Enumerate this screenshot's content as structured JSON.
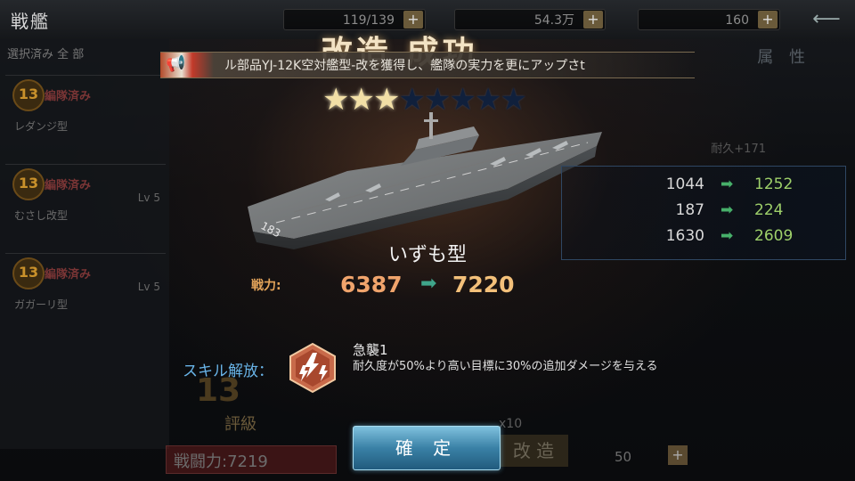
{
  "header": {
    "title": "戦艦",
    "resources": [
      {
        "value": "119/139"
      },
      {
        "value": "54.3万"
      },
      {
        "value": "160"
      }
    ],
    "plus_label": "+"
  },
  "left_list": {
    "filter_label": "選択済み 全 部",
    "items": [
      {
        "level_badge": "13",
        "tag": "編隊済み",
        "type": "レダンジ型"
      },
      {
        "level_badge": "13",
        "tag": "編隊済み",
        "lv": "Lv 5",
        "type": "むさし改型"
      },
      {
        "level_badge": "13",
        "tag": "編隊済み",
        "lv": "Lv 5",
        "type": "ガガーリ型"
      }
    ]
  },
  "right_panel": {
    "attr_label": "属 性",
    "durability": "耐久+171"
  },
  "banner": {
    "text": "ル部品YJ-12K空対艦型-改を獲得し、艦隊の実力を更にアップさt"
  },
  "result_title": "改造 成功",
  "rating": {
    "filled": 3,
    "total": 8
  },
  "ship": {
    "name": "いずも型",
    "hull_number": "183"
  },
  "combat_power": {
    "label": "戦力:",
    "old": "6387",
    "new": "7220"
  },
  "stats": [
    {
      "old": "1044",
      "new": "1252"
    },
    {
      "old": "187",
      "new": "224"
    },
    {
      "old": "1630",
      "new": "2609"
    }
  ],
  "skill": {
    "label": "スキル解放：",
    "name": "急襲1",
    "description": "耐久度が50%より高い目標に30%の追加ダメージを与える"
  },
  "bottom": {
    "confirm_label": "確 定",
    "rank_badge": "13",
    "rank_label": "評級",
    "battle_power_text": "戦闘力:7219",
    "kaizo_label": "改 造",
    "multiplier": "x10",
    "cost": "50",
    "cost_plus": "+"
  },
  "colors": {
    "accent_orange": "#f0a46c",
    "stat_green": "#9ed06a",
    "skill_blue": "#69b4e8",
    "confirm_blue": "#3a81a6"
  }
}
